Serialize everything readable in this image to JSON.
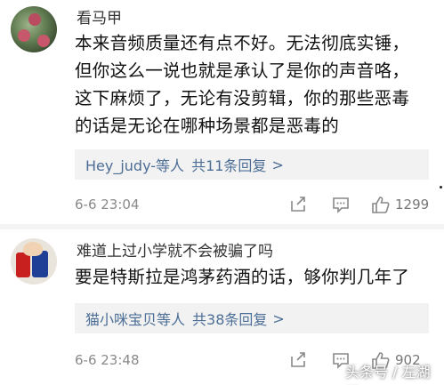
{
  "comments": [
    {
      "username": "看马甲",
      "lines": [
        "本来音频质量还有点不好。无法彻底实锤，",
        "但你这么一说也就是承认了是你的声音咯，",
        "这下麻烦了，无论有没剪辑，你的那些恶毒",
        "的话是无论在哪种场景都是恶毒的"
      ],
      "reply_users": "Hey_judy-等人",
      "reply_count": "共11条回复",
      "reply_arrow": ">",
      "time": "6-6 23:04",
      "likes": "1299"
    },
    {
      "username": "难道上过小学就不会被骗了吗",
      "lines": [
        "要是特斯拉是鸿茅药酒的话，够你判几年了"
      ],
      "reply_users": "猫小咪宝贝等人",
      "reply_count": "共38条回复",
      "reply_arrow": ">",
      "time": "6-6 23:48",
      "likes": "902"
    }
  ],
  "icons": {
    "share": "share-icon",
    "comment": "comment-icon",
    "like": "thumbs-up-icon"
  },
  "watermark": "头条号 / 左湖桥",
  "colors": {
    "link_blue": "#4c6e96",
    "reply_bg": "#f2f2f2",
    "meta_gray": "#8a8a8a"
  }
}
